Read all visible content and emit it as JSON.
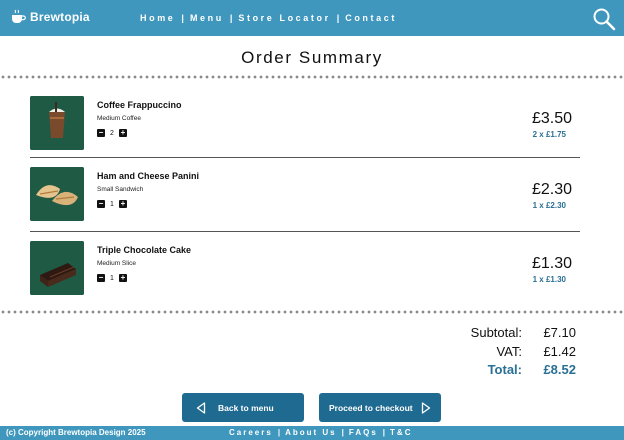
{
  "header": {
    "logo_text": "Brewtopia",
    "nav": [
      "Home",
      "Menu",
      "Store Locator",
      "Contact"
    ],
    "nav_separator": "|"
  },
  "page_title": "Order Summary",
  "items": [
    {
      "name": "Coffee Frappuccino",
      "desc": "Medium Coffee",
      "qty": "2",
      "price": "£3.50",
      "unit": "2 x £1.75",
      "icon": "coffee-frappuccino-image"
    },
    {
      "name": "Ham and Cheese Panini",
      "desc": "Small Sandwich",
      "qty": "1",
      "price": "£2.30",
      "unit": "1 x £2.30",
      "icon": "panini-image"
    },
    {
      "name": "Triple Chocolate Cake",
      "desc": "Medium Slice",
      "qty": "1",
      "price": "£1.30",
      "unit": "1 x £1.30",
      "icon": "chocolate-cake-image"
    }
  ],
  "qty_controls": {
    "minus": "−",
    "plus": "+"
  },
  "totals": {
    "subtotal_label": "Subtotal:",
    "subtotal": "£7.10",
    "vat_label": "VAT:",
    "vat": "£1.42",
    "total_label": "Total:",
    "total": "£8.52"
  },
  "buttons": {
    "back": "Back to menu",
    "checkout": "Proceed to checkout"
  },
  "footer": {
    "copyright": "(c) Copyright Brewtopia Design 2025",
    "links": [
      "Careers",
      "About Us",
      "FAQs",
      "T&C"
    ],
    "separator": "|"
  },
  "colors": {
    "header": "#3f97bd",
    "button": "#1f6a91",
    "accent": "#2a6f94",
    "thumb_bg": "#1f5a45"
  }
}
